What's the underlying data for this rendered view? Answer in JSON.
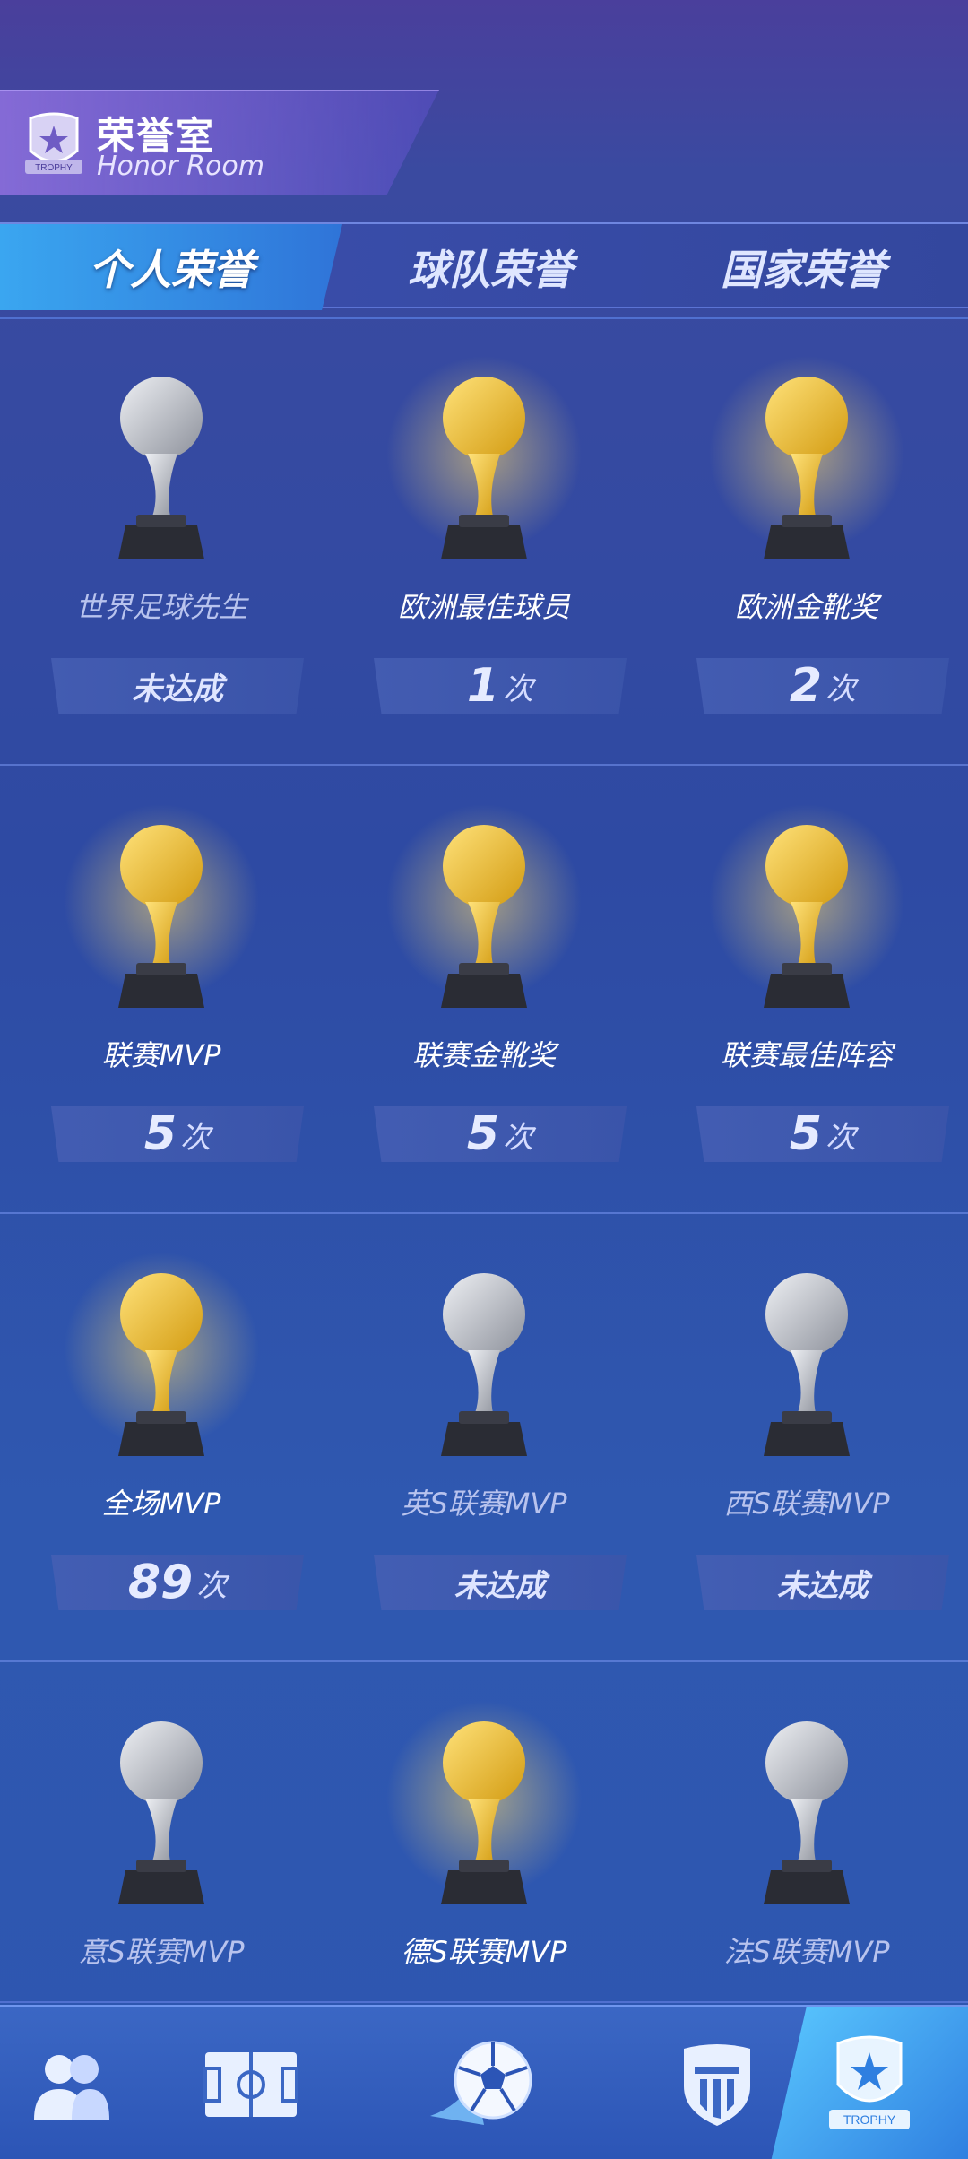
{
  "header": {
    "title_cn": "荣誉室",
    "title_en": "Honor Room",
    "logo_text": "TROPHY"
  },
  "tabs": [
    {
      "label": "个人荣誉"
    },
    {
      "label": "球队荣誉"
    },
    {
      "label": "国家荣誉"
    }
  ],
  "colors": {
    "gold": "#f2c230",
    "silver": "#c9ccd4",
    "accent": "#3aa6f0"
  },
  "trophies": [
    {
      "name": "世界足球先生",
      "count": "",
      "unit": "",
      "status": "未达成",
      "metal": "silver"
    },
    {
      "name": "欧洲最佳球员",
      "count": "1",
      "unit": "次",
      "status": "",
      "metal": "gold"
    },
    {
      "name": "欧洲金靴奖",
      "count": "2",
      "unit": "次",
      "status": "",
      "metal": "gold"
    },
    {
      "name": "联赛MVP",
      "count": "5",
      "unit": "次",
      "status": "",
      "metal": "gold"
    },
    {
      "name": "联赛金靴奖",
      "count": "5",
      "unit": "次",
      "status": "",
      "metal": "gold"
    },
    {
      "name": "联赛最佳阵容",
      "count": "5",
      "unit": "次",
      "status": "",
      "metal": "gold"
    },
    {
      "name": "全场MVP",
      "count": "89",
      "unit": "次",
      "status": "",
      "metal": "gold"
    },
    {
      "name": "英S联赛MVP",
      "count": "",
      "unit": "",
      "status": "未达成",
      "metal": "silver"
    },
    {
      "name": "西S联赛MVP",
      "count": "",
      "unit": "",
      "status": "未达成",
      "metal": "silver"
    },
    {
      "name": "意S联赛MVP",
      "count": "",
      "unit": "",
      "status": "",
      "metal": "silver"
    },
    {
      "name": "德S联赛MVP",
      "count": "",
      "unit": "",
      "status": "",
      "metal": "gold"
    },
    {
      "name": "法S联赛MVP",
      "count": "",
      "unit": "",
      "status": "",
      "metal": "silver"
    }
  ],
  "nav": [
    {
      "icon": "players-icon"
    },
    {
      "icon": "pitch-icon"
    },
    {
      "icon": "ball-icon"
    },
    {
      "icon": "club-badge-icon"
    },
    {
      "icon": "trophy-icon"
    }
  ]
}
